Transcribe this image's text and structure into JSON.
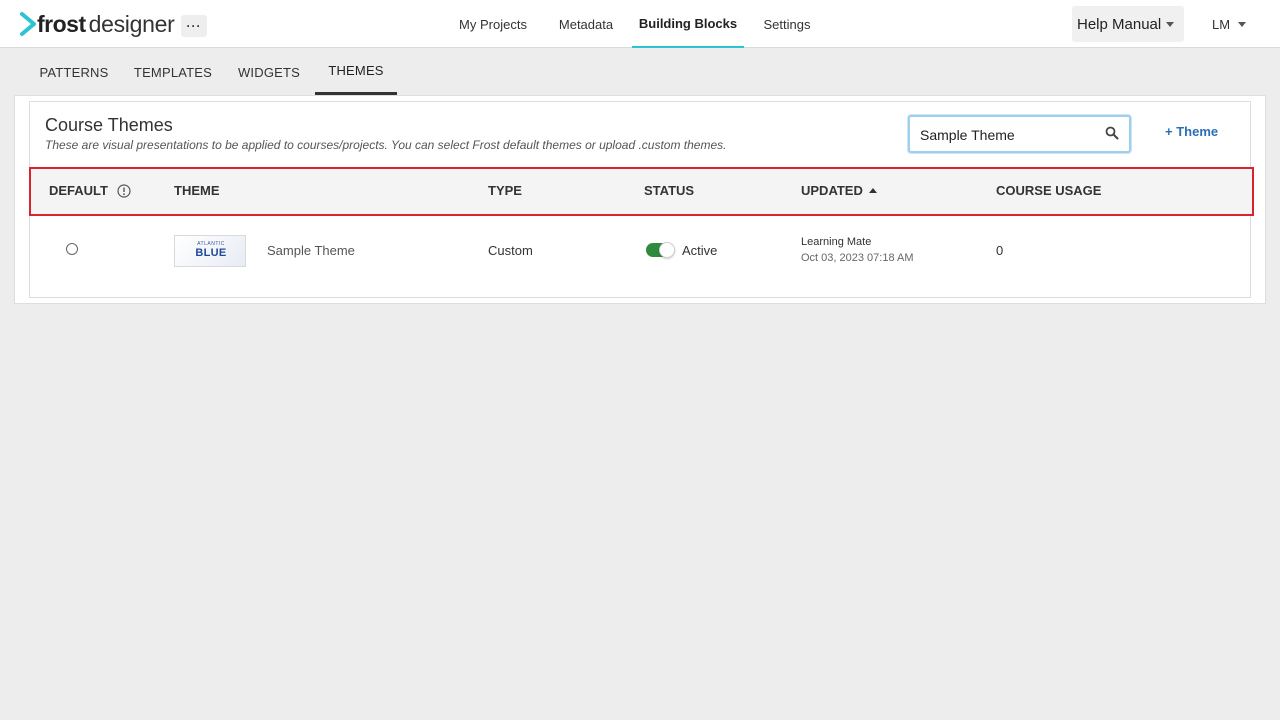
{
  "brand": {
    "frost": "frost",
    "designer": "designer",
    "accent": "#2bc4cf"
  },
  "topnav": {
    "more_label": "···",
    "items": [
      {
        "label": "My Projects",
        "active": false
      },
      {
        "label": "Metadata",
        "active": false
      },
      {
        "label": "Building Blocks",
        "active": true
      },
      {
        "label": "Settings",
        "active": false
      }
    ],
    "help_label": "Help Manual",
    "user_initials": "LM"
  },
  "subtabs": [
    {
      "label": "PATTERNS",
      "active": false
    },
    {
      "label": "TEMPLATES",
      "active": false
    },
    {
      "label": "WIDGETS",
      "active": false
    },
    {
      "label": "THEMES",
      "active": true
    }
  ],
  "section": {
    "title": "Course Themes",
    "description": "These are visual presentations to be applied to courses/projects. You can select Frost default themes or upload .custom themes.",
    "search_value": "Sample Theme",
    "add_button": "+ Theme"
  },
  "table": {
    "columns": {
      "default": "DEFAULT",
      "theme": "THEME",
      "type": "TYPE",
      "status": "STATUS",
      "updated": "UPDATED",
      "usage": "COURSE USAGE"
    },
    "sort": {
      "column": "UPDATED",
      "direction": "ascending"
    },
    "rows": [
      {
        "default_selected": false,
        "thumbnail_small": "ATLANTIC",
        "thumbnail_big": "BLUE",
        "name": "Sample Theme",
        "type": "Custom",
        "status": "Active",
        "status_on": true,
        "updated_by": "Learning Mate",
        "updated_at": "Oct 03, 2023 07:18 AM",
        "usage": "0"
      }
    ]
  },
  "colors": {
    "toggle_on": "#2f8a3d",
    "link": "#2b6fb5",
    "highlight_border": "#d9232e"
  }
}
